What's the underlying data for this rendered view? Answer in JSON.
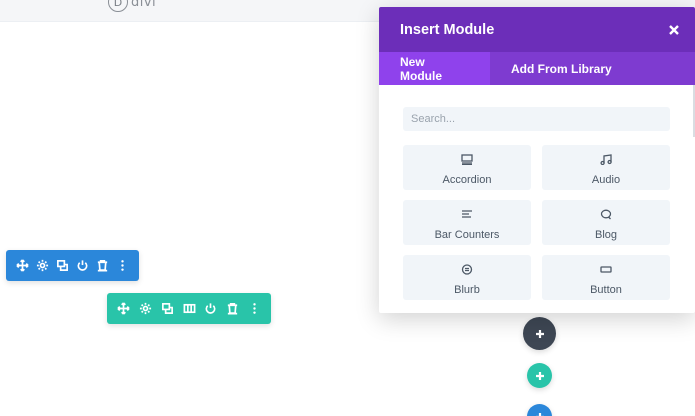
{
  "background": {
    "logo_text": "divi"
  },
  "modal": {
    "title": "Insert Module",
    "tabs": [
      {
        "label": "New Module",
        "active": true
      },
      {
        "label": "Add From Library",
        "active": false
      }
    ],
    "search": {
      "placeholder": "Search...",
      "value": ""
    },
    "modules": [
      {
        "label": "Accordion",
        "icon": "accordion-icon"
      },
      {
        "label": "Audio",
        "icon": "music-note-icon"
      },
      {
        "label": "Bar Counters",
        "icon": "bar-counters-icon"
      },
      {
        "label": "Blog",
        "icon": "chat-bubble-icon"
      },
      {
        "label": "Blurb",
        "icon": "blurb-icon"
      },
      {
        "label": "Button",
        "icon": "button-icon"
      }
    ]
  },
  "toolbars": {
    "row_actions": [
      "move-icon",
      "settings-icon",
      "duplicate-icon",
      "power-icon",
      "delete-icon",
      "more-icon"
    ],
    "module_actions": [
      "move-icon",
      "settings-icon",
      "duplicate-icon",
      "columns-icon",
      "power-icon",
      "delete-icon",
      "more-icon"
    ]
  },
  "colors": {
    "modal_header": "#6c2eb9",
    "tab_bar": "#7e3bd0",
    "tab_active": "#8f42ec",
    "row_toolbar": "#2b87da",
    "module_toolbar": "#29c4a9",
    "add_button_dark": "#3e4754"
  }
}
